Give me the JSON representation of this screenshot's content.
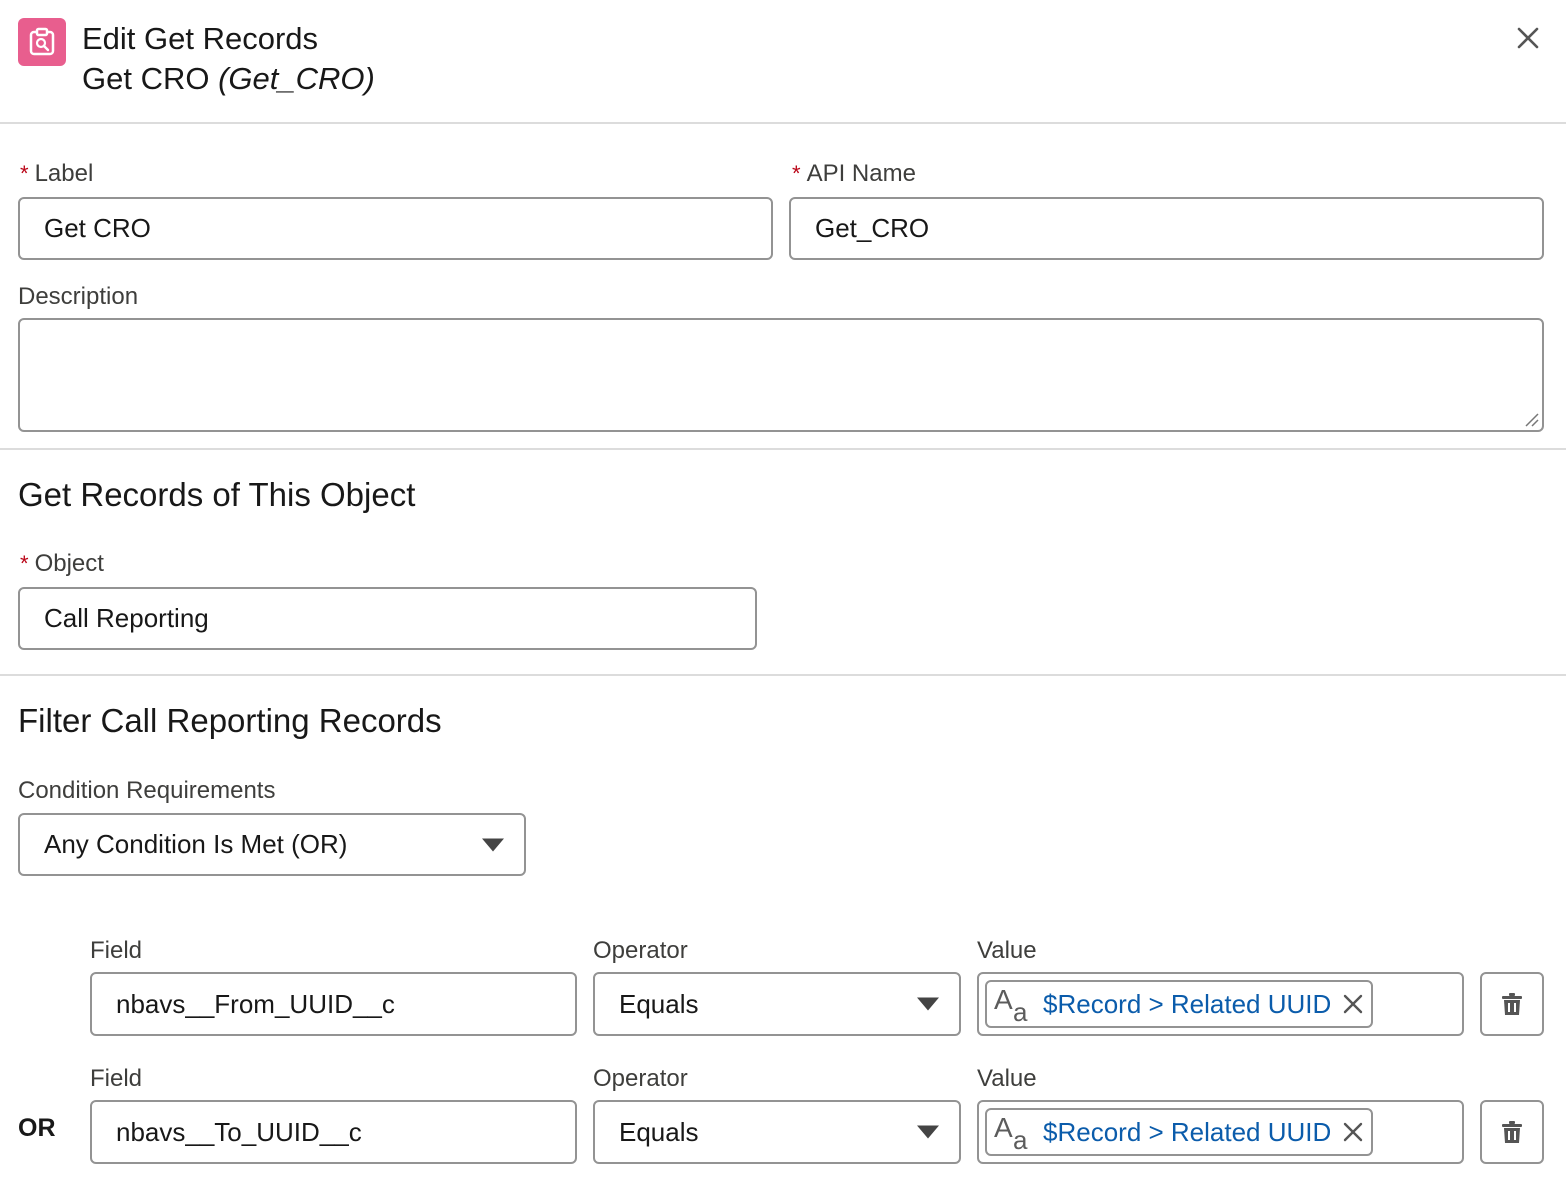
{
  "header": {
    "title": "Edit Get Records",
    "element_label": "Get CRO",
    "element_api": "(Get_CRO)",
    "icon": "get-records-icon",
    "icon_color": "#e85e8e"
  },
  "form": {
    "label_label": "Label",
    "label_value": "Get CRO",
    "api_name_label": "API Name",
    "api_name_value": "Get_CRO",
    "description_label": "Description",
    "description_value": ""
  },
  "object_section": {
    "title": "Get Records of This Object",
    "object_label": "Object",
    "object_value": "Call Reporting"
  },
  "filter_section": {
    "title": "Filter Call Reporting Records",
    "condition_label": "Condition Requirements",
    "condition_value": "Any Condition Is Met (OR)",
    "conditions": [
      {
        "field_label": "Field",
        "field_value": "nbavs__From_UUID__c",
        "operator_label": "Operator",
        "operator_value": "Equals",
        "value_label": "Value",
        "value_pill": "$Record > Related UUID"
      },
      {
        "logic": "OR",
        "field_label": "Field",
        "field_value": "nbavs__To_UUID__c",
        "operator_label": "Operator",
        "operator_value": "Equals",
        "value_label": "Value",
        "value_pill": "$Record > Related UUID"
      }
    ]
  },
  "colors": {
    "required_asterisk": "#ba0517",
    "pill_text": "#0b5cab",
    "border": "#939393"
  }
}
